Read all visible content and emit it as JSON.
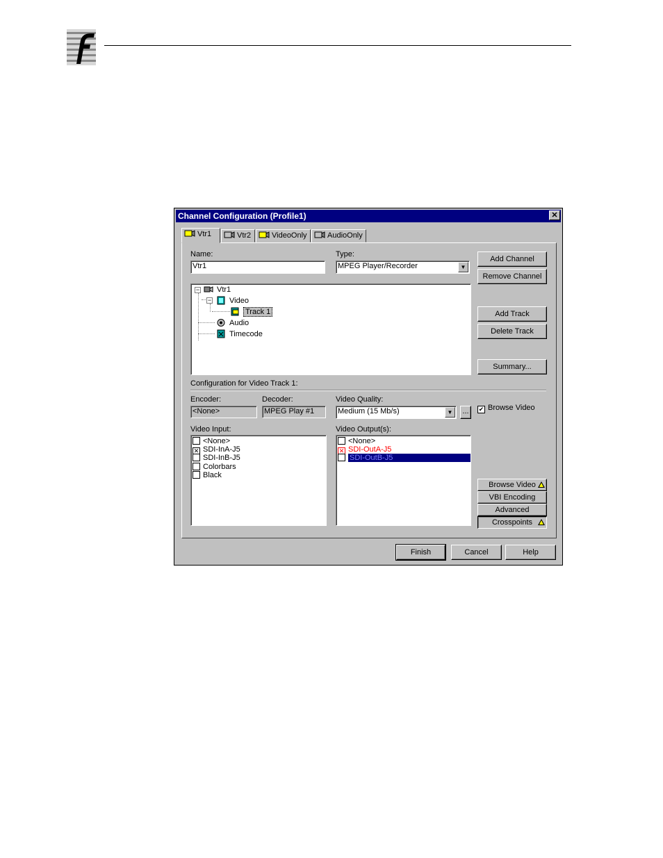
{
  "dialog": {
    "title": "Channel Configuration (Profile1)",
    "close_glyph": "✕",
    "tabs": [
      {
        "label": "Vtr1",
        "icon": "channel-icon",
        "active": true
      },
      {
        "label": "Vtr2",
        "icon": "channel-icon",
        "active": false
      },
      {
        "label": "VideoOnly",
        "icon": "channel-icon",
        "active": false
      },
      {
        "label": "AudioOnly",
        "icon": "channel-icon",
        "active": false
      }
    ],
    "name_label": "Name:",
    "name_value": "Vtr1",
    "type_label": "Type:",
    "type_value": "MPEG Player/Recorder",
    "buttons": {
      "add_channel": "Add Channel",
      "remove_channel": "Remove Channel",
      "add_track": "Add Track",
      "delete_track": "Delete Track",
      "summary": "Summary..."
    },
    "tree": {
      "root": "Vtr1",
      "video": "Video",
      "track": "Track 1",
      "audio": "Audio",
      "timecode": "Timecode"
    },
    "config_heading": "Configuration for Video Track 1:",
    "encoder_label": "Encoder:",
    "encoder_value": "<None>",
    "decoder_label": "Decoder:",
    "decoder_value": "MPEG Play #1",
    "quality_label": "Video Quality:",
    "quality_value": "Medium (15 Mb/s)",
    "quality_more": "...",
    "browse_video_check_label": "Browse Video",
    "video_input_label": "Video Input:",
    "video_inputs": [
      {
        "label": "<None>",
        "checked": false
      },
      {
        "label": "SDI-InA-J5",
        "checked": true
      },
      {
        "label": "SDI-InB-J5",
        "checked": false
      },
      {
        "label": "Colorbars",
        "checked": false
      },
      {
        "label": "Black",
        "checked": false
      }
    ],
    "video_output_label": "Video Output(s):",
    "video_outputs": [
      {
        "label": "<None>",
        "checked": false
      },
      {
        "label": "SDI-OutA-J5",
        "checked": true
      },
      {
        "label": "SDI-OutB-J5",
        "checked": false
      }
    ],
    "side_buttons": {
      "browse_video": "Browse Video",
      "vbi_encoding": "VBI Encoding",
      "advanced": "Advanced",
      "crosspoints": "Crosspoints"
    },
    "footer": {
      "finish": "Finish",
      "cancel": "Cancel",
      "help": "Help"
    },
    "colors": {
      "title_bar": "#000080",
      "face": "#c0c0c0",
      "error_text": "#ff0000",
      "selection": "#000080"
    }
  }
}
